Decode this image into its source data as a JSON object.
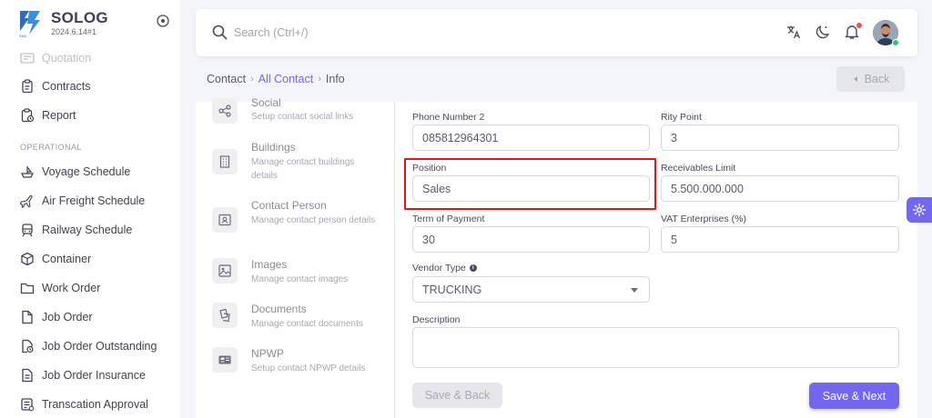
{
  "brand": {
    "name": "SOLOG",
    "version": "2024.6.14#1"
  },
  "sidebar": {
    "items_top": [
      {
        "label": "Quotation",
        "icon": "document-icon"
      },
      {
        "label": "Contracts",
        "icon": "clipboard-icon"
      },
      {
        "label": "Report",
        "icon": "report-icon"
      }
    ],
    "section_label": "OPERATIONAL",
    "items": [
      {
        "label": "Voyage Schedule",
        "icon": "ship-icon"
      },
      {
        "label": "Air Freight Schedule",
        "icon": "plane-icon"
      },
      {
        "label": "Railway Schedule",
        "icon": "train-icon"
      },
      {
        "label": "Container",
        "icon": "box-icon"
      },
      {
        "label": "Work Order",
        "icon": "folder-icon"
      },
      {
        "label": "Job Order",
        "icon": "file-icon"
      },
      {
        "label": "Job Order Outstanding",
        "icon": "file-clock-icon"
      },
      {
        "label": "Job Order Insurance",
        "icon": "file-text-icon"
      },
      {
        "label": "Transcation Approval",
        "icon": "checklist-icon"
      }
    ]
  },
  "search": {
    "placeholder": "Search (Ctrl+/)"
  },
  "breadcrumb": {
    "root": "Contact",
    "link": "All Contact",
    "current": "Info"
  },
  "back_button": {
    "label": "Back"
  },
  "tabs": [
    {
      "title": "Social",
      "desc": "Setup contact social links",
      "icon": "share-icon"
    },
    {
      "title": "Buildings",
      "desc": "Manage contact buildings details",
      "icon": "building-icon"
    },
    {
      "title": "Contact Person",
      "desc": "Manage contact person details",
      "icon": "contact-card-icon"
    },
    {
      "title": "Images",
      "desc": "Manage contact images",
      "icon": "image-icon"
    },
    {
      "title": "Documents",
      "desc": "Manage contact documents",
      "icon": "documents-icon"
    },
    {
      "title": "NPWP",
      "desc": "Setup contact NPWP details",
      "icon": "id-card-icon"
    }
  ],
  "form": {
    "phone2": {
      "label": "Phone Number 2",
      "value": "085812964301"
    },
    "rity_point": {
      "label": "Rity Point",
      "value": "3"
    },
    "position": {
      "label": "Position",
      "value": "Sales"
    },
    "receivables_limit": {
      "label": "Receivables Limit",
      "value": "5.500.000.000"
    },
    "term_of_payment": {
      "label": "Term of Payment",
      "value": "30"
    },
    "vat": {
      "label": "VAT Enterprises (%)",
      "value": "5"
    },
    "vendor_type": {
      "label": "Vendor Type",
      "value": "TRUCKING"
    },
    "description": {
      "label": "Description",
      "value": ""
    }
  },
  "buttons": {
    "save_back": "Save & Back",
    "save_next": "Save & Next"
  },
  "colors": {
    "primary": "#7367f0",
    "highlight": "#e3151a",
    "online": "#28c76f",
    "notification": "#ea5455"
  }
}
